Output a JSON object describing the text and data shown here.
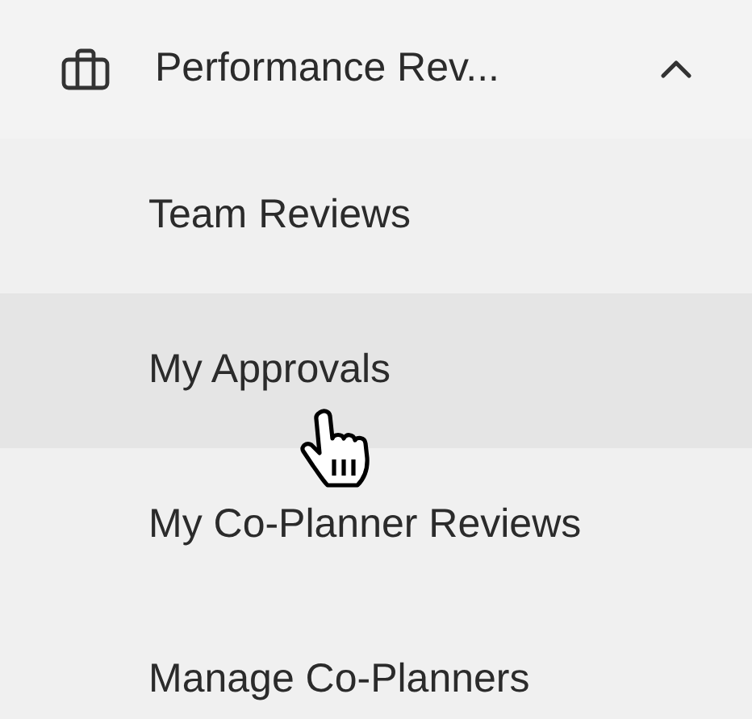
{
  "menu": {
    "label": "Performance Rev...",
    "expanded": true,
    "items": [
      {
        "label": "Team Reviews",
        "hovered": false
      },
      {
        "label": "My Approvals",
        "hovered": true
      },
      {
        "label": "My Co-Planner Reviews",
        "hovered": false
      },
      {
        "label": "Manage Co-Planners",
        "hovered": false
      }
    ]
  }
}
